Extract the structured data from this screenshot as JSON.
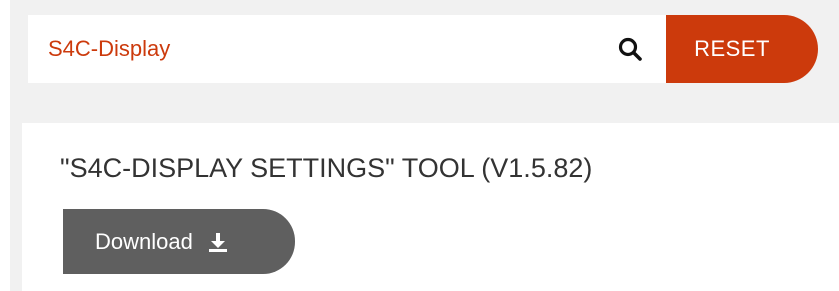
{
  "search": {
    "value": "S4C-Display",
    "icon": "search-icon",
    "reset_label": "RESET"
  },
  "result": {
    "title": "\"S4C-DISPLAY SETTINGS\" TOOL (V1.5.82)",
    "download_label": "Download",
    "download_icon": "download-icon"
  },
  "colors": {
    "accent": "#cc3a0c",
    "button_gray": "#5f5f5f",
    "background": "#f1f1f1"
  }
}
